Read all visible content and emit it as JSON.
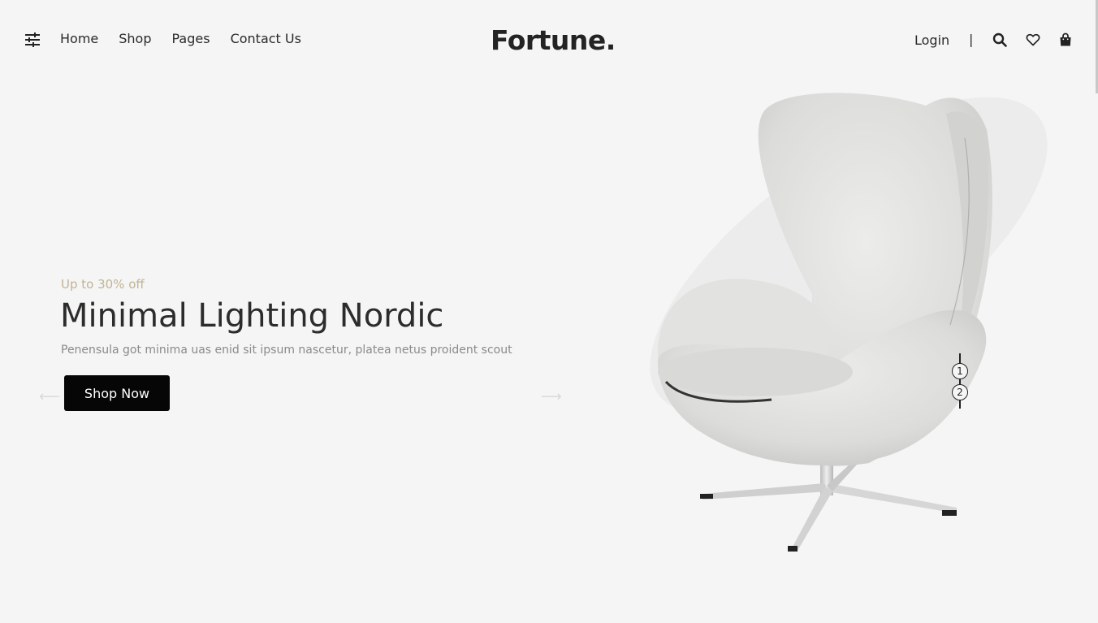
{
  "header": {
    "logo": "Fortune.",
    "nav": [
      {
        "label": "Home"
      },
      {
        "label": "Shop"
      },
      {
        "label": "Pages"
      },
      {
        "label": "Contact Us"
      }
    ],
    "login_label": "Login",
    "separator": "|",
    "icons": {
      "menu": "sliders-icon",
      "search": "search-icon",
      "wishlist": "heart-icon",
      "cart": "shopping-bag-icon"
    }
  },
  "hero": {
    "eyebrow": "Up to 30% off",
    "title": "Minimal Lighting Nordic",
    "description": "Penensula got minima uas enid sit ipsum nascetur, platea netus proident scout",
    "cta_label": "Shop Now",
    "prev_arrow": "⟵",
    "next_arrow": "⟶"
  },
  "slider": {
    "pages": [
      "1",
      "2"
    ],
    "active_page": "1"
  },
  "colors": {
    "background": "#f5f5f5",
    "accent": "#bfb493",
    "button": "#060606",
    "text": "#2c2c2c"
  }
}
